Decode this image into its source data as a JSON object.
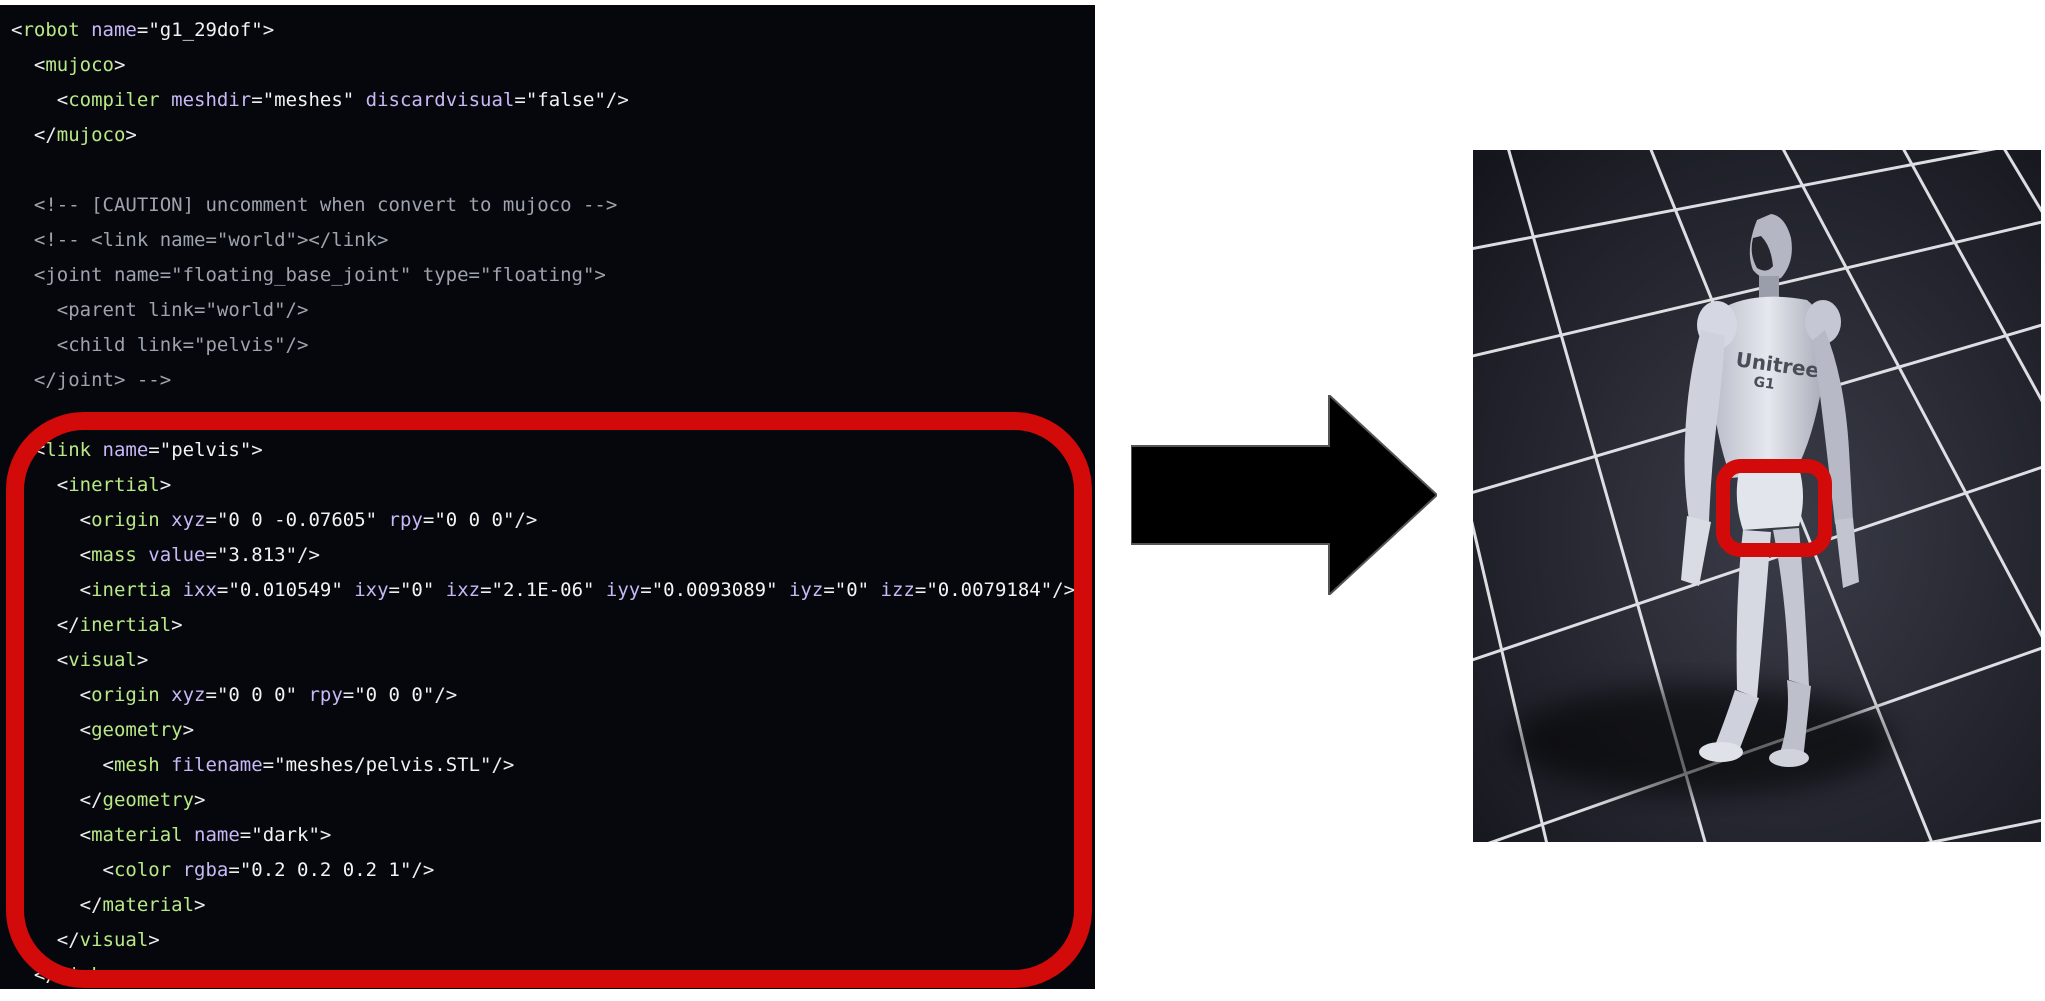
{
  "code": {
    "lines": [
      [
        {
          "t": "<",
          "c": "punct"
        },
        {
          "t": "robot",
          "c": "tag"
        },
        {
          "t": " name",
          "c": "attr"
        },
        {
          "t": "=",
          "c": "punct"
        },
        {
          "t": "\"g1_29dof\"",
          "c": "val"
        },
        {
          "t": ">",
          "c": "punct"
        }
      ],
      [
        {
          "t": "  <",
          "c": "punct"
        },
        {
          "t": "mujoco",
          "c": "tag"
        },
        {
          "t": ">",
          "c": "punct"
        }
      ],
      [
        {
          "t": "    <",
          "c": "punct"
        },
        {
          "t": "compiler",
          "c": "tag"
        },
        {
          "t": " meshdir",
          "c": "attr"
        },
        {
          "t": "=",
          "c": "punct"
        },
        {
          "t": "\"meshes\"",
          "c": "val"
        },
        {
          "t": " discardvisual",
          "c": "attr"
        },
        {
          "t": "=",
          "c": "punct"
        },
        {
          "t": "\"false\"",
          "c": "val"
        },
        {
          "t": "/>",
          "c": "punct"
        }
      ],
      [
        {
          "t": "  </",
          "c": "punct"
        },
        {
          "t": "mujoco",
          "c": "tag"
        },
        {
          "t": ">",
          "c": "punct"
        }
      ],
      [
        {
          "t": "",
          "c": "punct"
        }
      ],
      [
        {
          "t": "  <!-- [CAUTION] uncomment when convert to mujoco -->",
          "c": "comment"
        }
      ],
      [
        {
          "t": "  <!-- <link name=\"world\"></link>",
          "c": "comment"
        }
      ],
      [
        {
          "t": "  <joint name=\"floating_base_joint\" type=\"floating\">",
          "c": "comment"
        }
      ],
      [
        {
          "t": "    <parent link=\"world\"/>",
          "c": "comment"
        }
      ],
      [
        {
          "t": "    <child link=\"pelvis\"/>",
          "c": "comment"
        }
      ],
      [
        {
          "t": "  </joint> -->",
          "c": "comment"
        }
      ],
      [
        {
          "t": "",
          "c": "punct"
        }
      ],
      [
        {
          "t": "  <",
          "c": "punct"
        },
        {
          "t": "link",
          "c": "tag"
        },
        {
          "t": " name",
          "c": "attr"
        },
        {
          "t": "=",
          "c": "punct"
        },
        {
          "t": "\"pelvis\"",
          "c": "val"
        },
        {
          "t": ">",
          "c": "punct"
        }
      ],
      [
        {
          "t": "    <",
          "c": "punct"
        },
        {
          "t": "inertial",
          "c": "tag"
        },
        {
          "t": ">",
          "c": "punct"
        }
      ],
      [
        {
          "t": "      <",
          "c": "punct"
        },
        {
          "t": "origin",
          "c": "tag"
        },
        {
          "t": " xyz",
          "c": "attr"
        },
        {
          "t": "=",
          "c": "punct"
        },
        {
          "t": "\"0 0 -0.07605\"",
          "c": "val"
        },
        {
          "t": " rpy",
          "c": "attr"
        },
        {
          "t": "=",
          "c": "punct"
        },
        {
          "t": "\"0 0 0\"",
          "c": "val"
        },
        {
          "t": "/>",
          "c": "punct"
        }
      ],
      [
        {
          "t": "      <",
          "c": "punct"
        },
        {
          "t": "mass",
          "c": "tag"
        },
        {
          "t": " value",
          "c": "attr"
        },
        {
          "t": "=",
          "c": "punct"
        },
        {
          "t": "\"3.813\"",
          "c": "val"
        },
        {
          "t": "/>",
          "c": "punct"
        }
      ],
      [
        {
          "t": "      <",
          "c": "punct"
        },
        {
          "t": "inertia",
          "c": "tag"
        },
        {
          "t": " ixx",
          "c": "attr"
        },
        {
          "t": "=",
          "c": "punct"
        },
        {
          "t": "\"0.010549\"",
          "c": "val"
        },
        {
          "t": " ixy",
          "c": "attr"
        },
        {
          "t": "=",
          "c": "punct"
        },
        {
          "t": "\"0\"",
          "c": "val"
        },
        {
          "t": " ixz",
          "c": "attr"
        },
        {
          "t": "=",
          "c": "punct"
        },
        {
          "t": "\"2.1E-06\"",
          "c": "val"
        },
        {
          "t": " iyy",
          "c": "attr"
        },
        {
          "t": "=",
          "c": "punct"
        },
        {
          "t": "\"0.0093089\"",
          "c": "val"
        },
        {
          "t": " iyz",
          "c": "attr"
        },
        {
          "t": "=",
          "c": "punct"
        },
        {
          "t": "\"0\"",
          "c": "val"
        },
        {
          "t": " izz",
          "c": "attr"
        },
        {
          "t": "=",
          "c": "punct"
        },
        {
          "t": "\"0.0079184\"",
          "c": "val"
        },
        {
          "t": "/>",
          "c": "punct"
        }
      ],
      [
        {
          "t": "    </",
          "c": "punct"
        },
        {
          "t": "inertial",
          "c": "tag"
        },
        {
          "t": ">",
          "c": "punct"
        }
      ],
      [
        {
          "t": "    <",
          "c": "punct"
        },
        {
          "t": "visual",
          "c": "tag"
        },
        {
          "t": ">",
          "c": "punct"
        }
      ],
      [
        {
          "t": "      <",
          "c": "punct"
        },
        {
          "t": "origin",
          "c": "tag"
        },
        {
          "t": " xyz",
          "c": "attr"
        },
        {
          "t": "=",
          "c": "punct"
        },
        {
          "t": "\"0 0 0\"",
          "c": "val"
        },
        {
          "t": " rpy",
          "c": "attr"
        },
        {
          "t": "=",
          "c": "punct"
        },
        {
          "t": "\"0 0 0\"",
          "c": "val"
        },
        {
          "t": "/>",
          "c": "punct"
        }
      ],
      [
        {
          "t": "      <",
          "c": "punct"
        },
        {
          "t": "geometry",
          "c": "tag"
        },
        {
          "t": ">",
          "c": "punct"
        }
      ],
      [
        {
          "t": "        <",
          "c": "punct"
        },
        {
          "t": "mesh",
          "c": "tag"
        },
        {
          "t": " filename",
          "c": "attr"
        },
        {
          "t": "=",
          "c": "punct"
        },
        {
          "t": "\"meshes/pelvis.STL\"",
          "c": "val"
        },
        {
          "t": "/>",
          "c": "punct"
        }
      ],
      [
        {
          "t": "      </",
          "c": "punct"
        },
        {
          "t": "geometry",
          "c": "tag"
        },
        {
          "t": ">",
          "c": "punct"
        }
      ],
      [
        {
          "t": "      <",
          "c": "punct"
        },
        {
          "t": "material",
          "c": "tag"
        },
        {
          "t": " name",
          "c": "attr"
        },
        {
          "t": "=",
          "c": "punct"
        },
        {
          "t": "\"dark\"",
          "c": "val"
        },
        {
          "t": ">",
          "c": "punct"
        }
      ],
      [
        {
          "t": "        <",
          "c": "punct"
        },
        {
          "t": "color",
          "c": "tag"
        },
        {
          "t": " rgba",
          "c": "attr"
        },
        {
          "t": "=",
          "c": "punct"
        },
        {
          "t": "\"0.2 0.2 0.2 1\"",
          "c": "val"
        },
        {
          "t": "/>",
          "c": "punct"
        }
      ],
      [
        {
          "t": "      </",
          "c": "punct"
        },
        {
          "t": "material",
          "c": "tag"
        },
        {
          "t": ">",
          "c": "punct"
        }
      ],
      [
        {
          "t": "    </",
          "c": "punct"
        },
        {
          "t": "visual",
          "c": "tag"
        },
        {
          "t": ">",
          "c": "punct"
        }
      ],
      [
        {
          "t": "  </",
          "c": "punct"
        },
        {
          "t": "link",
          "c": "tag"
        },
        {
          "t": ">",
          "c": "punct"
        }
      ]
    ]
  },
  "render": {
    "brand_text": "Unitree",
    "model_text": "G1"
  },
  "colors": {
    "highlight": "#d20a0a",
    "code_background": "#05070d",
    "tag": "#b8e986",
    "attribute": "#c9b8f5",
    "comment": "#9ea3ad",
    "arrow": "#000000"
  }
}
